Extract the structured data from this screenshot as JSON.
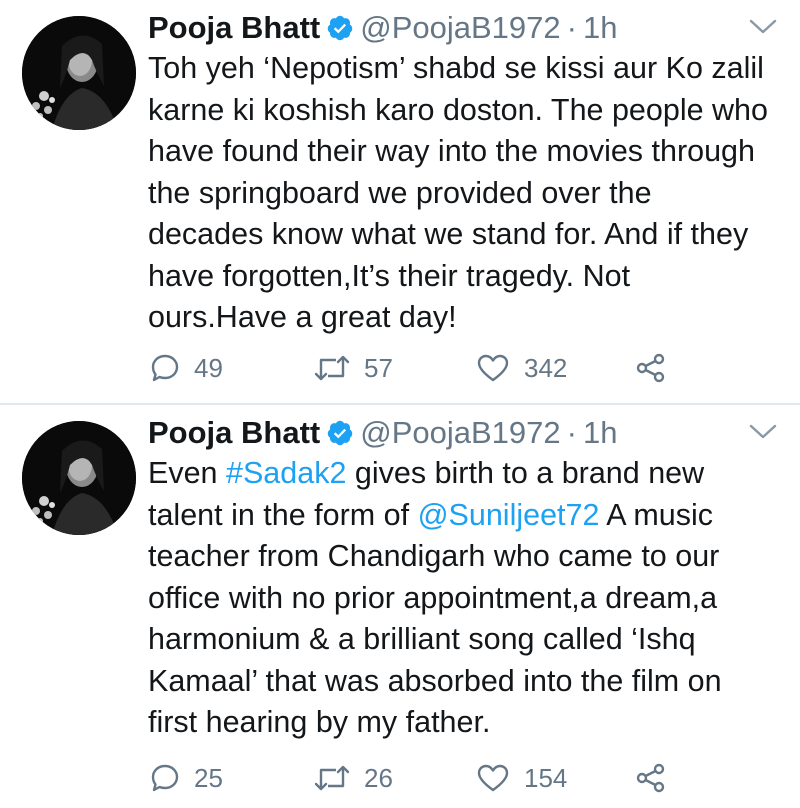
{
  "tweets": [
    {
      "name": "Pooja Bhatt",
      "handle": "@PoojaB1972",
      "separator": "·",
      "time": "1h",
      "lines": [
        "Toh yeh ‘Nepotism’ shabd se kissi aur Ko zalil",
        "karne ki koshish karo doston. The people who",
        "have found their way into the movies through",
        "the springboard we provided over the",
        "decades know what we stand for. And if they",
        "have forgotten,It’s their tragedy. Not",
        "ours.Have a great day!"
      ],
      "replies": "49",
      "retweets": "57",
      "likes": "342"
    },
    {
      "name": "Pooja Bhatt",
      "handle": "@PoojaB1972",
      "separator": "·",
      "time": "1h",
      "line1_pre": "Even ",
      "line1_hashtag": "#Sadak2",
      "line1_post": " gives birth to a brand new",
      "line2_pre": "talent in the form of ",
      "line2_mention": "@Suniljeet72",
      "line2_post": " A music",
      "lines_rest": [
        "teacher from Chandigarh who came to our",
        "office with no prior appointment,a dream,a",
        "harmonium & a brilliant song called ‘Ishq",
        "Kamaal’ that was absorbed into the film on",
        "first hearing by my father."
      ],
      "replies": "25",
      "retweets": "26",
      "likes": "154"
    }
  ],
  "colors": {
    "text": "#14171a",
    "secondary": "#657786",
    "link": "#1da1f2",
    "verified": "#1da1f2",
    "divider": "#e1e8ed"
  },
  "icons": {
    "verified": "verified-badge-icon",
    "menu": "chevron-down-icon",
    "reply": "reply-icon",
    "retweet": "retweet-icon",
    "like": "heart-icon",
    "share": "share-icon"
  }
}
